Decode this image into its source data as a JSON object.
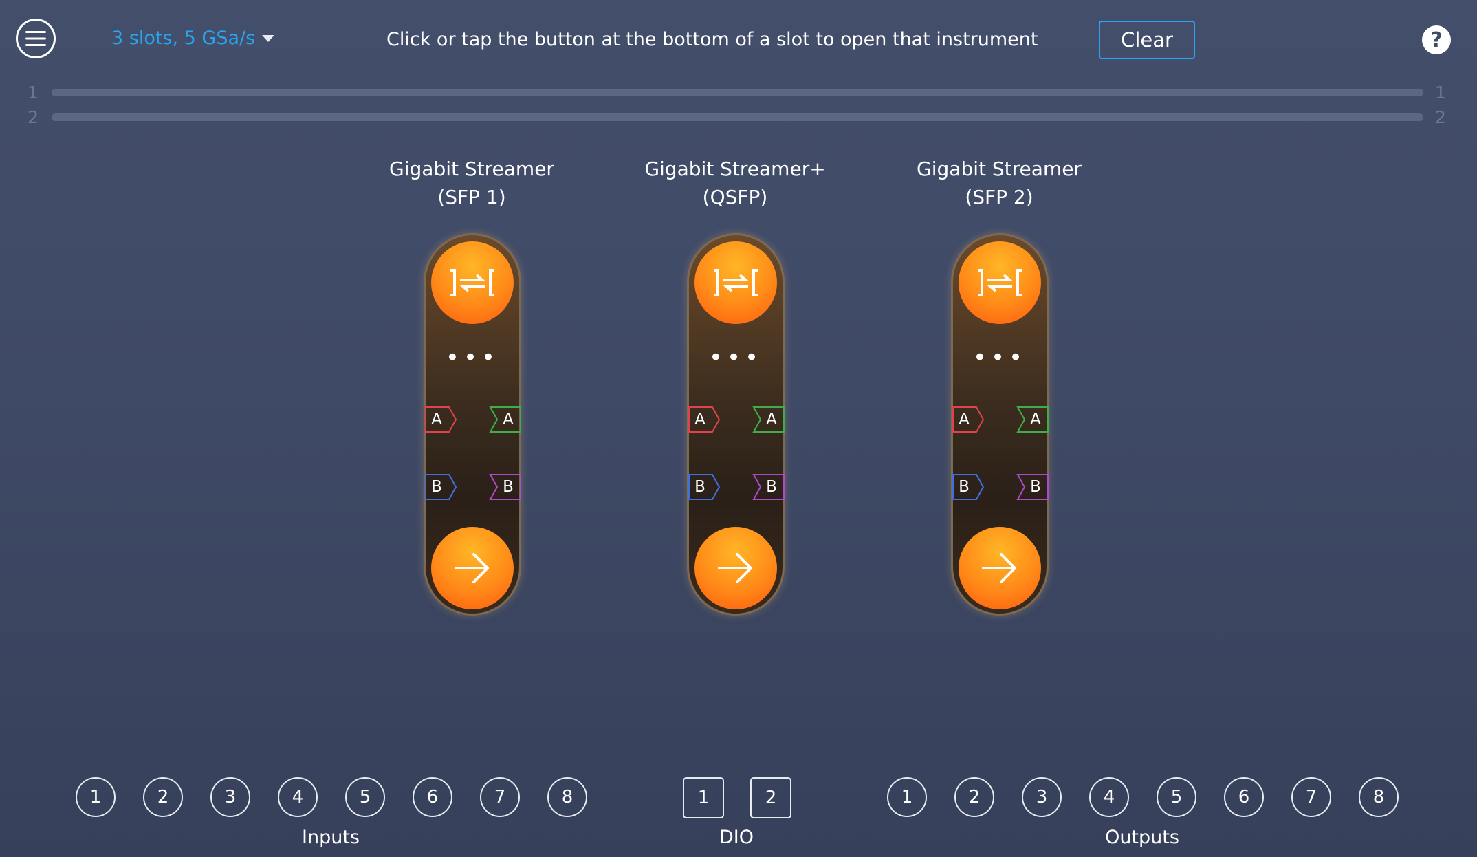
{
  "header": {
    "config_label": "3 slots, 5 GSa/s",
    "instructions": "Click or tap the button at the bottom of a slot to open that instrument",
    "clear_label": "Clear",
    "help_label": "?"
  },
  "tracks": [
    {
      "left": "1",
      "right": "1"
    },
    {
      "left": "2",
      "right": "2"
    }
  ],
  "slots": [
    {
      "line1": "Gigabit Streamer",
      "line2": "(SFP 1)",
      "ports": {
        "in_a": "A",
        "out_a": "A",
        "in_b": "B",
        "out_b": "B"
      }
    },
    {
      "line1": "Gigabit Streamer+",
      "line2": "(QSFP)",
      "ports": {
        "in_a": "A",
        "out_a": "A",
        "in_b": "B",
        "out_b": "B"
      }
    },
    {
      "line1": "Gigabit Streamer",
      "line2": "(SFP 2)",
      "ports": {
        "in_a": "A",
        "out_a": "A",
        "in_b": "B",
        "out_b": "B"
      }
    }
  ],
  "slot_dots": "•••",
  "inputs": {
    "label": "Inputs",
    "items": [
      "1",
      "2",
      "3",
      "4",
      "5",
      "6",
      "7",
      "8"
    ]
  },
  "dio": {
    "label": "DIO",
    "items": [
      "1",
      "2"
    ]
  },
  "outputs": {
    "label": "Outputs",
    "items": [
      "1",
      "2",
      "3",
      "4",
      "5",
      "6",
      "7",
      "8"
    ]
  },
  "colors": {
    "accent": "#2aa4ee",
    "port_in_a": "#e0434b",
    "port_out_a": "#3fae4a",
    "port_in_b": "#3f6fe0",
    "port_out_b": "#b04ac8",
    "orb": "#ff8a18"
  },
  "icons": {
    "menu": "hamburger-menu-icon",
    "dropdown": "caret-down-icon",
    "slot_top": "streamer-icon",
    "slot_bottom": "arrow-right-icon"
  }
}
